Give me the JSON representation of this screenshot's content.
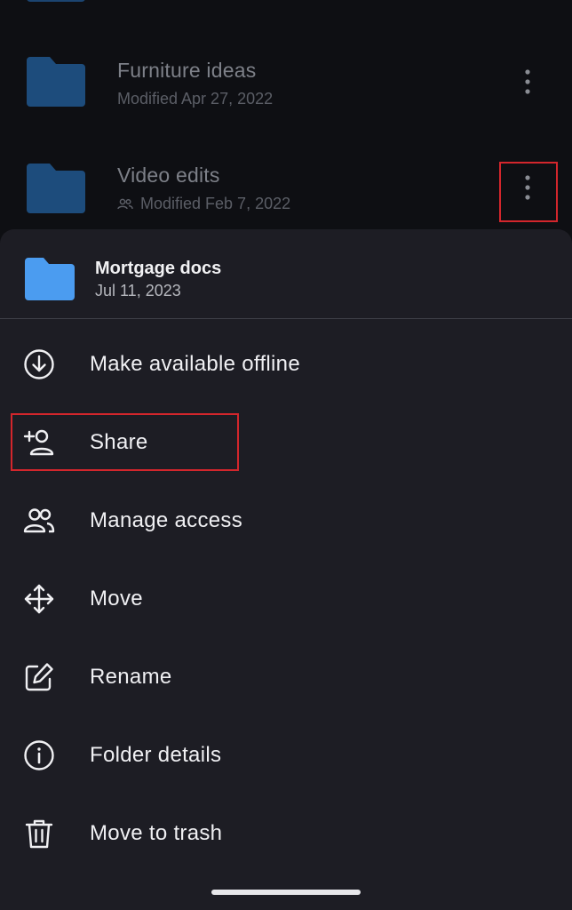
{
  "background_list": {
    "rows": [
      {
        "title": "Furniture ideas",
        "subtitle": "Modified Apr 27, 2022",
        "shared": false
      },
      {
        "title": "Video edits",
        "subtitle": "Modified Feb 7, 2022",
        "shared": true
      }
    ]
  },
  "sheet": {
    "title": "Mortgage docs",
    "date": "Jul 11, 2023",
    "items": [
      {
        "label": "Make available offline",
        "icon": "download-circle-icon"
      },
      {
        "label": "Share",
        "icon": "person-add-icon"
      },
      {
        "label": "Manage access",
        "icon": "people-icon"
      },
      {
        "label": "Move",
        "icon": "move-arrows-icon"
      },
      {
        "label": "Rename",
        "icon": "edit-icon"
      },
      {
        "label": "Folder details",
        "icon": "info-icon"
      },
      {
        "label": "Move to trash",
        "icon": "trash-icon"
      }
    ]
  },
  "colors": {
    "highlight": "#d3262c",
    "folder_dim": "#1d4c7c",
    "folder_bright": "#4b9cf0",
    "sheet_bg": "#1d1d24"
  }
}
